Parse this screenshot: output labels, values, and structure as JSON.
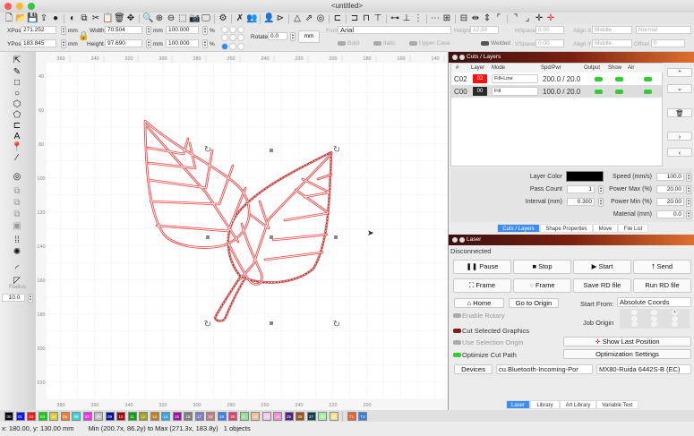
{
  "window": {
    "title": "<untitled>"
  },
  "toolbar": {
    "icons": [
      "new-file",
      "open-folder",
      "save",
      "export",
      "cut-path",
      "trace",
      "copy",
      "scissors",
      "paste",
      "trash",
      "move",
      "zoom-in",
      "zoom-region",
      "zoom-out",
      "select-frame",
      "camera",
      "monitor",
      "gear",
      "tools",
      "group",
      "user",
      "mirror-h",
      "mirror-v",
      "arrange",
      "target",
      "align-left",
      "align-center",
      "align-right",
      "align-top",
      "align-middle",
      "align-bottom",
      "distribute-h",
      "distribute-v",
      "dock-left",
      "dock-right",
      "space-h",
      "space-v",
      "corner-tl",
      "corner-tr",
      "corner-br",
      "crosshair",
      "crosshair-red"
    ]
  },
  "props": {
    "xpos_label": "XPos",
    "xpos": "271.252",
    "ypos_label": "YPos",
    "ypos": "183.845",
    "unit": "mm",
    "width_label": "Width",
    "width": "70.504",
    "height_label": "Height",
    "height": "97.690",
    "scale_w": "100.000",
    "scale_h": "100.000",
    "percent": "%",
    "rotate_label": "Rotate",
    "rotate": "0.0",
    "mm_button": "mm",
    "font_label": "Font",
    "font": "Arial",
    "text_height_label": "Height",
    "text_height": "12.50",
    "hspace_label": "HSpace",
    "hspace": "0.00",
    "vspace_label": "VSpace",
    "vspace": "0.00",
    "alignx_label": "Align X",
    "alignx": "Middle",
    "aligny_label": "Align Y",
    "aligny": "Middle",
    "normal": "Normal",
    "offset_label": "Offset",
    "offset": "0",
    "bold": "Bold",
    "italic": "Italic",
    "upper": "Upper Case",
    "welded": "Welded"
  },
  "left_tools": {
    "icons": [
      "select-arrow",
      "pencil",
      "rectangle",
      "ellipse",
      "polygon",
      "edit-nodes",
      "tab",
      "text",
      "position-pin",
      "measure",
      "offset",
      "boolean-union",
      "boolean-subtract",
      "boolean-intersect",
      "weld",
      "grid-array",
      "circular-array",
      "corner-round",
      "corner-chamfer"
    ],
    "radius_label": "Radius:",
    "radius": "10.0"
  },
  "rulers": {
    "top": [
      "360",
      "340",
      "320",
      "300",
      "280",
      "260",
      "240",
      "220",
      "200",
      "180",
      "160",
      "140"
    ],
    "left": [
      "40",
      "60",
      "80",
      "100",
      "120",
      "140",
      "160",
      "180",
      "200",
      "220"
    ],
    "bottom": [
      "380",
      "360",
      "340",
      "320",
      "300",
      "280",
      "260",
      "240",
      "220",
      "200"
    ]
  },
  "cuts": {
    "title": "Cuts / Layers",
    "headers": [
      "#",
      "Layer",
      "Mode",
      "Spd/Pwr",
      "Output",
      "Show",
      "Air"
    ],
    "rows": [
      {
        "num": "C02",
        "layer": "02",
        "color": "#ff1010",
        "mode": "Fill+Line",
        "spdpwr": "200.0 / 20.0",
        "output": true,
        "show": true,
        "air": true
      },
      {
        "num": "C00",
        "layer": "00",
        "color": "#2a2a2a",
        "mode": "Fill",
        "spdpwr": "100.0 / 20.0",
        "output": true,
        "show": true,
        "air": true
      }
    ],
    "layer_color_label": "Layer Color",
    "layer_color": "#000000",
    "pass_count_label": "Pass Count",
    "pass_count": "1",
    "interval_label": "Interval (mm)",
    "interval": "0.300",
    "speed_label": "Speed (mm/s)",
    "speed": "100.0",
    "power_max_label": "Power Max (%)",
    "power_max": "20.00",
    "power_min_label": "Power Min (%)",
    "power_min": "20.00",
    "material_label": "Material (mm)",
    "material": "0.0",
    "tabs": [
      "Cuts / Layers",
      "Shape Properties",
      "Move",
      "File List"
    ]
  },
  "laser": {
    "title": "Laser",
    "status": "Disconnected",
    "pause": "Pause",
    "stop": "Stop",
    "start": "Start",
    "send": "Send",
    "frame1": "Frame",
    "frame2": "Frame",
    "save_rd": "Save RD file",
    "run_rd": "Run RD file",
    "home": "Home",
    "origin": "Go to Origin",
    "start_from_label": "Start From:",
    "start_from": "Absolute Coords",
    "job_origin_label": "Job Origin",
    "enable_rotary": "Enable Rotary",
    "cut_selected": "Cut Selected Graphics",
    "use_sel_origin": "Use Selection Origin",
    "optimize": "Optimize Cut Path",
    "show_last": "Show Last Position",
    "opt_settings": "Optimization Settings",
    "devices": "Devices",
    "port": "cu.Bluetooth-Incoming-Por",
    "device": "MX80-Ruida 6442S-B (EC)",
    "tabs": [
      "Laser",
      "Library",
      "Art Library",
      "Variable Text"
    ]
  },
  "palette": [
    {
      "l": "00",
      "c": "#000000"
    },
    {
      "l": "01",
      "c": "#1010ff"
    },
    {
      "l": "02",
      "c": "#ff1010"
    },
    {
      "l": "03",
      "c": "#10d010"
    },
    {
      "l": "04",
      "c": "#d0d030"
    },
    {
      "l": "05",
      "c": "#f08030"
    },
    {
      "l": "06",
      "c": "#30d8d8"
    },
    {
      "l": "07",
      "c": "#f030f0"
    },
    {
      "l": "08",
      "c": "#c0c0c0"
    },
    {
      "l": "09",
      "c": "#0010a0"
    },
    {
      "l": "10",
      "c": "#a00010"
    },
    {
      "l": "11",
      "c": "#10a010"
    },
    {
      "l": "12",
      "c": "#a0a020"
    },
    {
      "l": "13",
      "c": "#c08020"
    },
    {
      "l": "14",
      "c": "#30a8f0"
    },
    {
      "l": "15",
      "c": "#a010a0"
    },
    {
      "l": "16",
      "c": "#808080"
    },
    {
      "l": "17",
      "c": "#8080c0"
    },
    {
      "l": "18",
      "c": "#c08080"
    },
    {
      "l": "19",
      "c": "#4080f0"
    },
    {
      "l": "20",
      "c": "#e04070"
    },
    {
      "l": "21",
      "c": "#90e090"
    },
    {
      "l": "22",
      "c": "#f0c090"
    },
    {
      "l": "23",
      "c": "#f0c8e8"
    },
    {
      "l": "24",
      "c": "#f090d0"
    },
    {
      "l": "25",
      "c": "#502080"
    },
    {
      "l": "26",
      "c": "#a05010"
    },
    {
      "l": "27",
      "c": "#104050"
    },
    {
      "l": "28",
      "c": "#a0f0a0"
    },
    {
      "l": "29",
      "c": "#f0e090"
    },
    {
      "l": "T1",
      "c": "#f06030"
    },
    {
      "l": "T2",
      "c": "#3080e0"
    }
  ],
  "status": {
    "cursor": "x: 180.00, y: 130.00 mm",
    "bounds": "Min (200.7x, 86.2y) to Max (271.3x, 183.8y)",
    "objects": "1 objects"
  }
}
